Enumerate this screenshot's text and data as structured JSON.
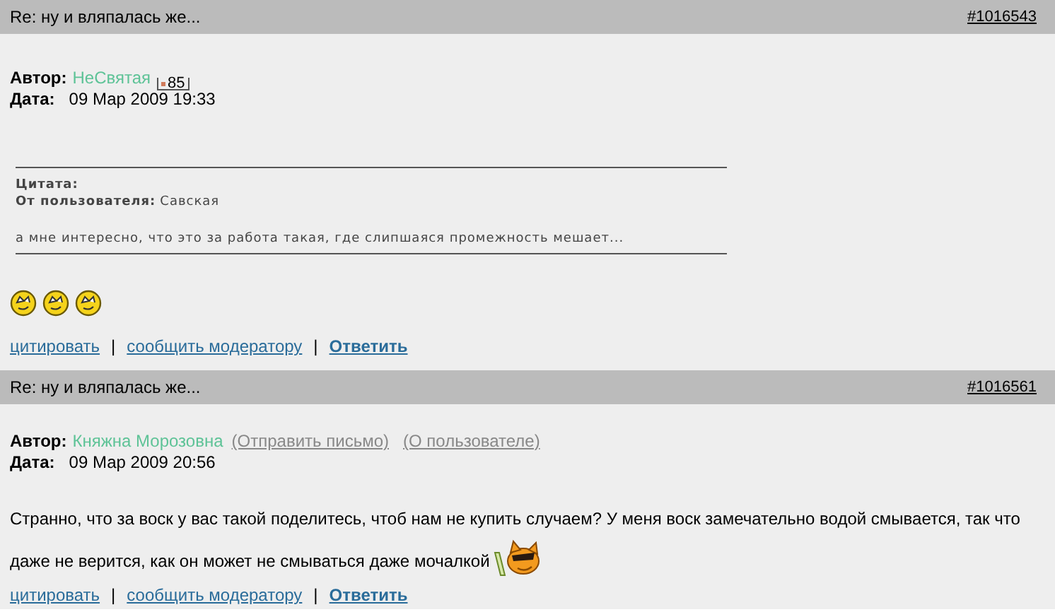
{
  "posts": [
    {
      "title": "Re: ну и вляпалась же...",
      "number": "#1016543",
      "author_label": "Автор:",
      "author": "НеСвятая",
      "badge": "85",
      "date_label": "Дата:",
      "date": "09 Мар 2009 19:33",
      "quote": {
        "heading": "Цитата:",
        "from_label": "От пользователя:",
        "from": "Савская",
        "text": "а мне интересно, что это за работа такая, где слипшаяся промежность мешает..."
      },
      "smileys": [
        {
          "kind": "yellow"
        },
        {
          "kind": "yellow"
        },
        {
          "kind": "yellow"
        }
      ],
      "actions": [
        {
          "kind": "link",
          "label": "цитировать"
        },
        {
          "kind": "separator",
          "label": "|"
        },
        {
          "kind": "link",
          "label": "сообщить модератору"
        },
        {
          "kind": "separator",
          "label": "|"
        },
        {
          "kind": "strong",
          "label": "Ответить"
        }
      ]
    },
    {
      "title": "Re: ну и вляпалась же...",
      "number": "#1016561",
      "author_label": "Автор:",
      "author": "Княжна Морозовна",
      "author_links": [
        "(Отправить письмо)",
        "(О пользователе)"
      ],
      "date_label": "Дата:",
      "date": "09 Мар 2009 20:56",
      "lines": [
        "Странно, что за воск у вас такой поделитесь, чтоб нам не купить случаем? У меня воск замечательно водой смывается, так что",
        "даже не верится, как он может не смываться даже мочалкой"
      ],
      "smileys": [
        {
          "kind": "cat"
        }
      ],
      "actions": [
        {
          "kind": "link",
          "label": "цитировать"
        },
        {
          "kind": "separator",
          "label": "|"
        },
        {
          "kind": "link",
          "label": "сообщить модератору"
        },
        {
          "kind": "separator",
          "label": "|"
        },
        {
          "kind": "strong",
          "label": "Ответить"
        }
      ]
    }
  ]
}
